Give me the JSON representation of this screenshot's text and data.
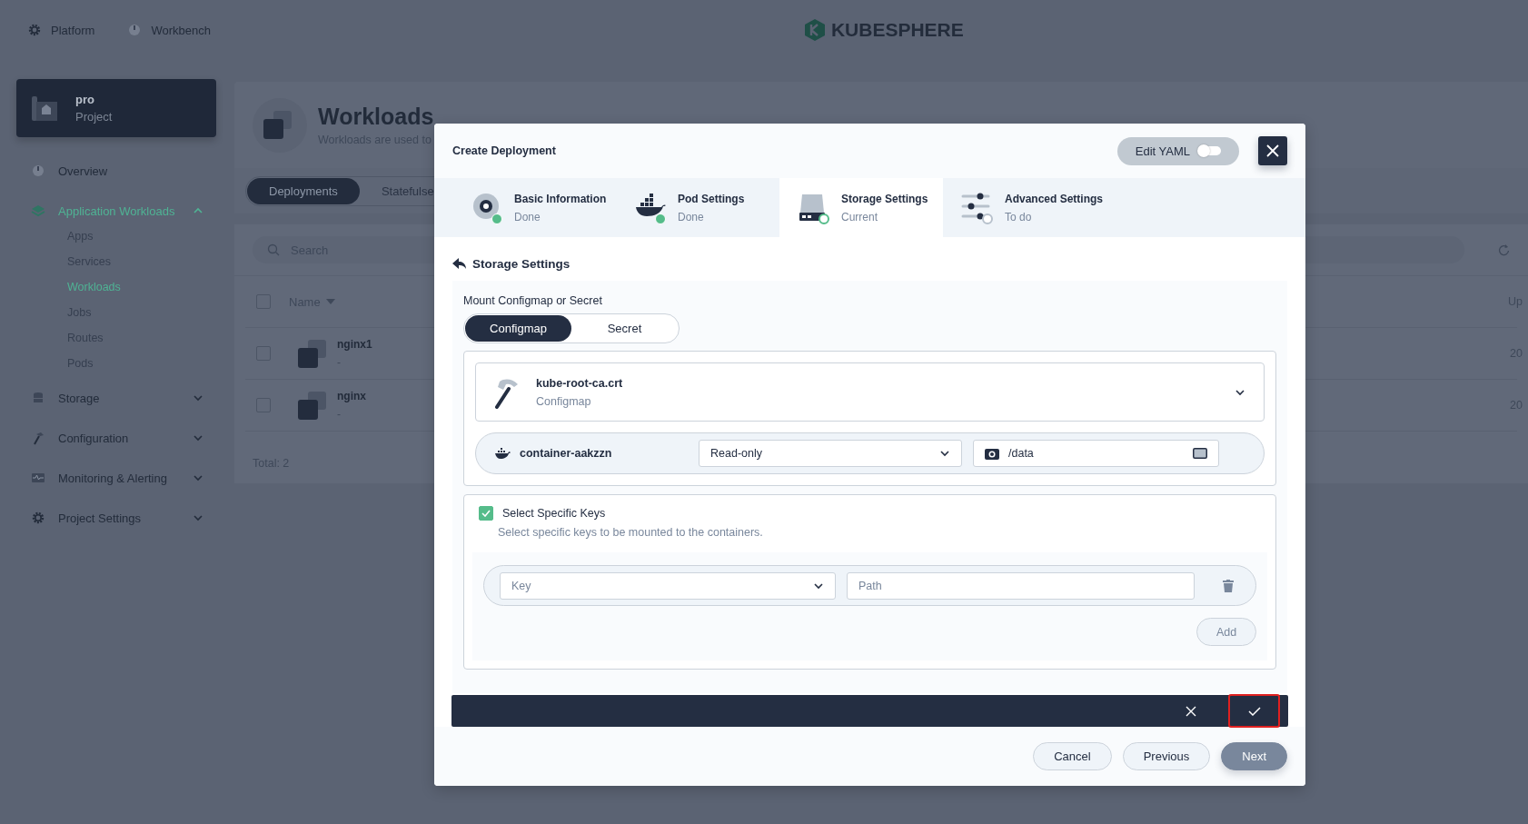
{
  "top_nav": [
    {
      "label": "Platform"
    },
    {
      "label": "Workbench"
    }
  ],
  "logo": {
    "text": "KUBESPHERE"
  },
  "project": {
    "name": "pro",
    "type": "Project"
  },
  "sidebar": {
    "items": [
      {
        "label": "Overview",
        "selected": false
      },
      {
        "label": "Application Workloads",
        "selected": true,
        "expanded": true,
        "children": [
          {
            "label": "Apps",
            "selected": false
          },
          {
            "label": "Services",
            "selected": false
          },
          {
            "label": "Workloads",
            "selected": true
          },
          {
            "label": "Jobs",
            "selected": false
          },
          {
            "label": "Routes",
            "selected": false
          },
          {
            "label": "Pods",
            "selected": false
          }
        ]
      },
      {
        "label": "Storage",
        "selected": false,
        "expanded": false
      },
      {
        "label": "Configuration",
        "selected": false,
        "expanded": false
      },
      {
        "label": "Monitoring & Alerting",
        "selected": false,
        "expanded": false
      },
      {
        "label": "Project Settings",
        "selected": false,
        "expanded": false
      }
    ]
  },
  "page": {
    "title": "Workloads",
    "description": "Workloads are used to",
    "tabs": [
      {
        "label": "Deployments",
        "selected": true
      },
      {
        "label": "Statefulse",
        "selected": false
      }
    ],
    "search": {
      "placeholder": "Search"
    },
    "table": {
      "all_checked": false,
      "columns": [
        {
          "label": "Name"
        },
        {
          "label": "Up"
        }
      ],
      "rows": [
        {
          "name": "nginx1",
          "description": "-",
          "column_2": "20",
          "checked": false
        },
        {
          "name": "nginx",
          "description": "-",
          "column_2": "20",
          "checked": false
        }
      ]
    },
    "total": "Total: 2"
  },
  "modal": {
    "title": "Create Deployment",
    "edit_yaml": {
      "label": "Edit YAML",
      "on": false
    },
    "steps": [
      {
        "kind": "basic",
        "label": "Basic Information",
        "status": "Done",
        "done": true,
        "selected": false
      },
      {
        "kind": "pod",
        "label": "Pod Settings",
        "status": "Done",
        "done": true,
        "selected": false
      },
      {
        "kind": "storage",
        "label": "Storage Settings",
        "status": "Current",
        "done": false,
        "selected": true
      },
      {
        "kind": "advanced",
        "label": "Advanced Settings",
        "status": "To do",
        "done": false,
        "selected": false
      }
    ],
    "section_title": "Storage Settings",
    "mount_label": "Mount Configmap or Secret",
    "mount_types": [
      {
        "label": "Configmap",
        "selected": true
      },
      {
        "label": "Secret",
        "selected": false
      }
    ],
    "resource": {
      "name": "kube-root-ca.crt",
      "type": "Configmap"
    },
    "container": {
      "name": "container-aakzzn",
      "access": "Read-only",
      "mount_path": "/data"
    },
    "select_keys": {
      "label": "Select Specific Keys",
      "checked": true,
      "description": "Select specific keys to be mounted to the containers.",
      "rows": [
        {
          "key_placeholder": "Key",
          "path_placeholder": "Path"
        }
      ],
      "add": "Add"
    },
    "confirm_bar": {
      "confirm_highlighted": true
    },
    "footer": [
      {
        "label": "Cancel",
        "kind": "default"
      },
      {
        "label": "Previous",
        "kind": "default"
      },
      {
        "label": "Next",
        "kind": "primary"
      }
    ]
  }
}
